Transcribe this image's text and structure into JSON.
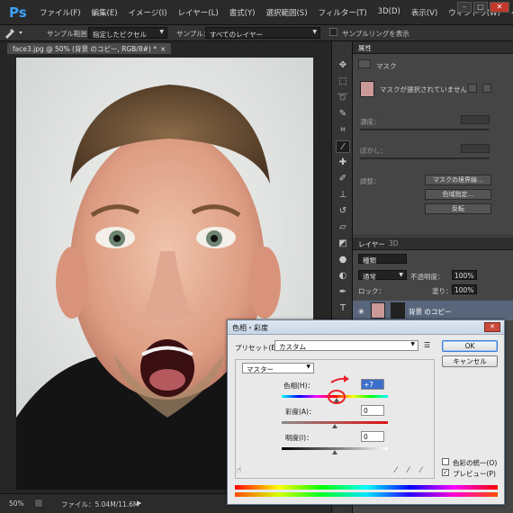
{
  "app": {
    "logo": "Ps",
    "menu": [
      "ファイル(F)",
      "編集(E)",
      "イメージ(I)",
      "レイヤー(L)",
      "書式(Y)",
      "選択範囲(S)",
      "フィルター(T)",
      "3D(D)",
      "表示(V)",
      "ウィンドウ(W)",
      "ヘルプ("
    ],
    "window_controls": [
      "–",
      "□",
      "✕"
    ]
  },
  "options": {
    "sample_size_label": "サンプル範囲：",
    "sample_size_value": "指定したピクセル",
    "sample_label": "サンプル：",
    "sample_value": "すべてのレイヤー",
    "show_ring_label": "サンプルリングを表示"
  },
  "document": {
    "tab_title": "face3.jpg @ 50% (背景 のコピー, RGB/8#) *",
    "tab_close": "×"
  },
  "status": {
    "zoom": "50%",
    "file_info": "ファイル：5.04M/11.6M",
    "arrow": "▶"
  },
  "properties": {
    "tab": "属性",
    "mask_label": "マスク",
    "no_mask_selected": "マスクが選択されていません",
    "density_label": "濃度：",
    "feather_label": "ぼかし：",
    "adjust_label": "調整：",
    "mask_edge_button": "マスクの境界線…",
    "color_range_button": "色域指定…",
    "invert_button": "反転"
  },
  "layers": {
    "tab": "レイヤー",
    "tab_3d": "3D",
    "kind_label": "種類",
    "blend_mode": "通常",
    "opacity_label": "不透明度：",
    "opacity_value": "100%",
    "lock_label": "ロック：",
    "fill_label": "塗り：",
    "fill_value": "100%",
    "layer_name": "背景 のコピー"
  },
  "dialog": {
    "title": "色相・彩度",
    "close": "✕",
    "preset_label": "プリセット(E)：",
    "preset_value": "カスタム",
    "ok_button": "OK",
    "cancel_button": "キャンセル",
    "channel_value": "マスター",
    "hue_label": "色相(H)：",
    "hue_value": "+7",
    "saturation_label": "彩度(A)：",
    "saturation_value": "0",
    "lightness_label": "明度(I)：",
    "lightness_value": "0",
    "colorize_label": "色彩の統一(O)",
    "preview_label": "プレビュー(P)",
    "preview_check": "✓",
    "colorize_checked": false,
    "preview_checked": true,
    "hue": 7,
    "saturation": 0,
    "lightness": 0
  },
  "annotation_color": "#e8232b",
  "accent_color": "#3b6fcb"
}
